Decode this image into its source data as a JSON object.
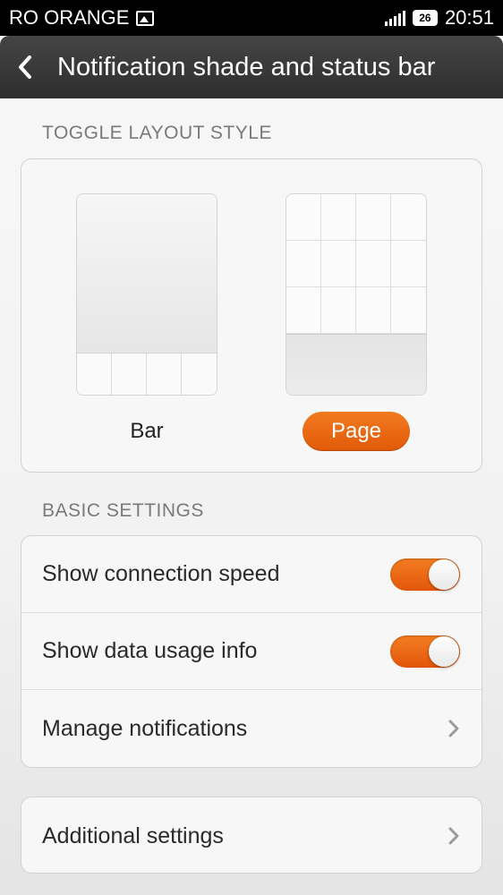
{
  "status_bar": {
    "carrier": "RO ORANGE",
    "battery": "26",
    "time": "20:51"
  },
  "header": {
    "title": "Notification shade and status bar"
  },
  "toggle_layout": {
    "section_title": "TOGGLE LAYOUT STYLE",
    "options": [
      {
        "label": "Bar",
        "selected": false
      },
      {
        "label": "Page",
        "selected": true
      }
    ]
  },
  "basic_settings": {
    "section_title": "BASIC SETTINGS",
    "items": [
      {
        "label": "Show connection speed",
        "type": "toggle",
        "on": true
      },
      {
        "label": "Show data usage info",
        "type": "toggle",
        "on": true
      },
      {
        "label": "Manage notifications",
        "type": "link"
      }
    ]
  },
  "additional": {
    "label": "Additional settings"
  },
  "colors": {
    "accent": "#e8640f",
    "action_bar": "#3a3a3a",
    "status_bar": "#000000"
  }
}
